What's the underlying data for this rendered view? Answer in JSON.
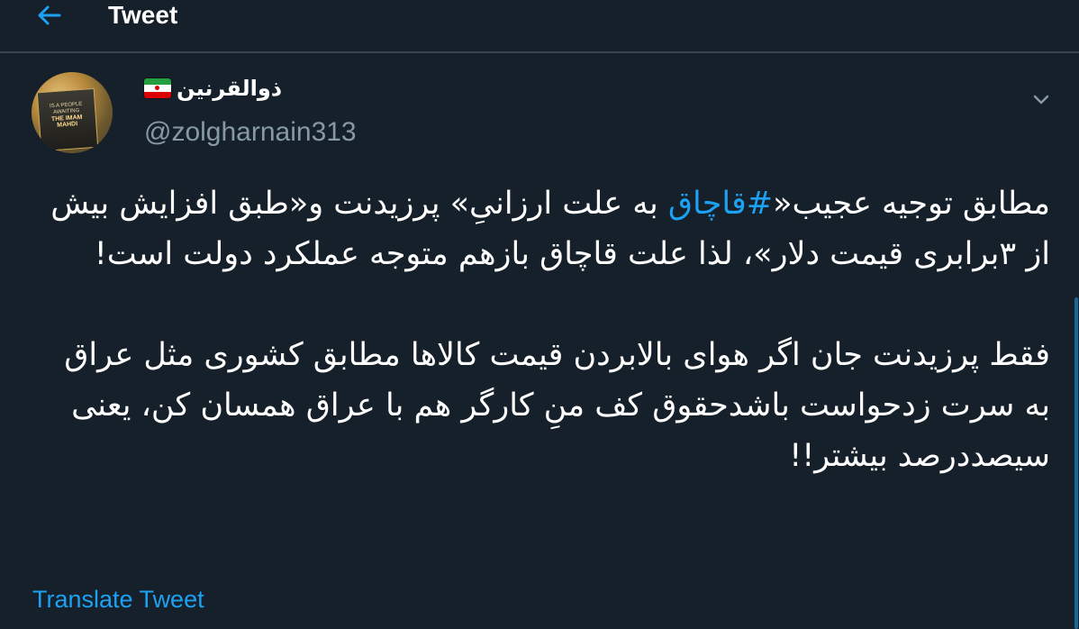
{
  "header": {
    "title": "Tweet",
    "back_icon": "arrow-left-icon"
  },
  "author": {
    "display_name": "ذوالقرنین",
    "flag_icon": "iran-flag-icon",
    "handle": "@zolgharnain313",
    "avatar_text_line1": "IS A PEOPLE AWAITING",
    "avatar_text_line2": "THE IMAM MAHDI"
  },
  "tweet": {
    "para1_before": "مطابق توجیه عجیب«",
    "hashtag": "#قاچاق",
    "para1_after": " به علت ارزانیِ» پرزیدنت و«طبق افزایش بیش از ۳برابری قیمت دلار»، لذا علت قاچاق بازهم متوجه عملکرد دولت است!",
    "para2": "فقط پرزیدنت جان اگر هوای بالابردن قیمت کالاها مطابق کشوری مثل عراق به سرت زدحواست باشدحقوق کف منِ کارگر هم با عراق همسان کن، یعنی سیصددرصد بیشتر!!"
  },
  "actions": {
    "translate_label": "Translate Tweet",
    "more_icon": "chevron-down-icon"
  },
  "colors": {
    "background": "#15202b",
    "accent": "#1da1f2",
    "secondary_text": "#8899a6",
    "divider": "#38444d"
  }
}
